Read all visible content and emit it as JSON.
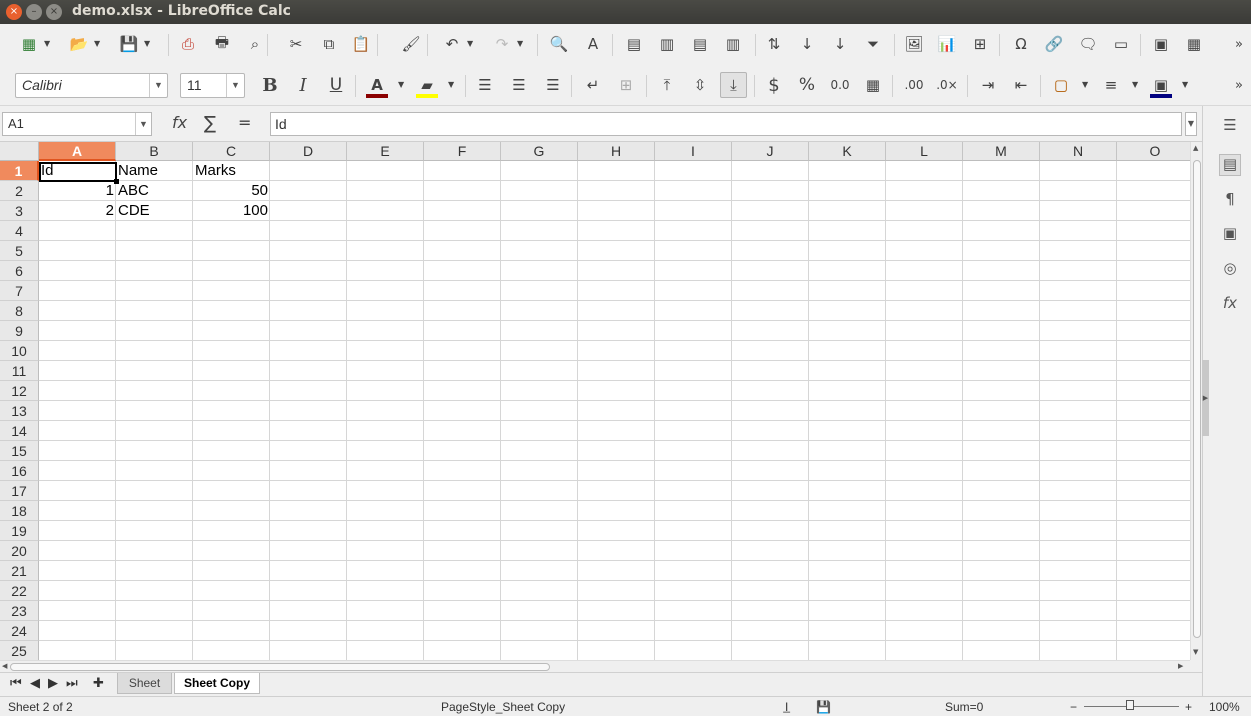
{
  "window": {
    "title": "demo.xlsx - LibreOffice Calc",
    "close": "×",
    "minimize": "–",
    "maximize": "×"
  },
  "toolbar1": [
    {
      "name": "new-spreadsheet",
      "glyph": "▦"
    },
    {
      "name": "open",
      "glyph": "📂"
    },
    {
      "name": "save",
      "glyph": "💾"
    },
    {
      "name": "export-pdf",
      "glyph": "⎙"
    },
    {
      "name": "print",
      "glyph": "🖶"
    },
    {
      "name": "print-preview",
      "glyph": "⌕"
    },
    {
      "name": "cut",
      "glyph": "✂"
    },
    {
      "name": "copy",
      "glyph": "⧉"
    },
    {
      "name": "paste",
      "glyph": "📋"
    },
    {
      "name": "clone-formatting",
      "glyph": "🖌"
    },
    {
      "name": "undo",
      "glyph": "↶"
    },
    {
      "name": "redo",
      "glyph": "↷"
    },
    {
      "name": "find-replace",
      "glyph": "🔍"
    },
    {
      "name": "spelling",
      "glyph": "A"
    },
    {
      "name": "row",
      "glyph": "▤"
    },
    {
      "name": "column",
      "glyph": "▥"
    },
    {
      "name": "delete-row",
      "glyph": "▤"
    },
    {
      "name": "delete-column",
      "glyph": "▥"
    },
    {
      "name": "sort",
      "glyph": "⇅"
    },
    {
      "name": "sort-ascending",
      "glyph": "↓"
    },
    {
      "name": "sort-descending",
      "glyph": "↓"
    },
    {
      "name": "autofilter",
      "glyph": "⏷"
    },
    {
      "name": "insert-image",
      "glyph": "🖼"
    },
    {
      "name": "insert-chart",
      "glyph": "📊"
    },
    {
      "name": "pivot-table",
      "glyph": "⊞"
    },
    {
      "name": "special-character",
      "glyph": "Ω"
    },
    {
      "name": "hyperlink",
      "glyph": "🔗"
    },
    {
      "name": "comment",
      "glyph": "🗨"
    },
    {
      "name": "headers-footers",
      "glyph": "▭"
    },
    {
      "name": "define-print-area",
      "glyph": "▣"
    },
    {
      "name": "freeze-rows-columns",
      "glyph": "▦"
    }
  ],
  "toolbar2": {
    "font_name": "Calibri",
    "font_size": "11",
    "bold": "B",
    "italic": "I",
    "underline": "U",
    "font_color": "#8b0000",
    "highlight_color": "#ffff00",
    "border_color": "#000080"
  },
  "formula_bar": {
    "name_box": "A1",
    "formula": "Id",
    "function_wizard": "fx",
    "sum": "∑",
    "equals": "="
  },
  "columns": [
    "A",
    "B",
    "C",
    "D",
    "E",
    "F",
    "G",
    "H",
    "I",
    "J",
    "K",
    "L",
    "M",
    "N",
    "O"
  ],
  "rows": [
    "1",
    "2",
    "3",
    "4",
    "5",
    "6",
    "7",
    "8",
    "9",
    "10",
    "11",
    "12",
    "13",
    "14",
    "15",
    "16",
    "17",
    "18",
    "19",
    "20",
    "21",
    "22",
    "23",
    "24",
    "25"
  ],
  "cells": {
    "A1": "Id",
    "B1": "Name",
    "C1": "Marks",
    "A2": "1",
    "B2": "ABC",
    "C2": "50",
    "A3": "2",
    "B3": "CDE",
    "C3": "100"
  },
  "selection": {
    "column": "A",
    "row": "1"
  },
  "sheet_tabs": [
    {
      "label": "Sheet",
      "active": false
    },
    {
      "label": "Sheet Copy",
      "active": true
    }
  ],
  "status_bar": {
    "sheet_info": "Sheet 2 of 2",
    "page_style": "PageStyle_Sheet Copy",
    "sum": "Sum=0",
    "zoom": "100%"
  }
}
